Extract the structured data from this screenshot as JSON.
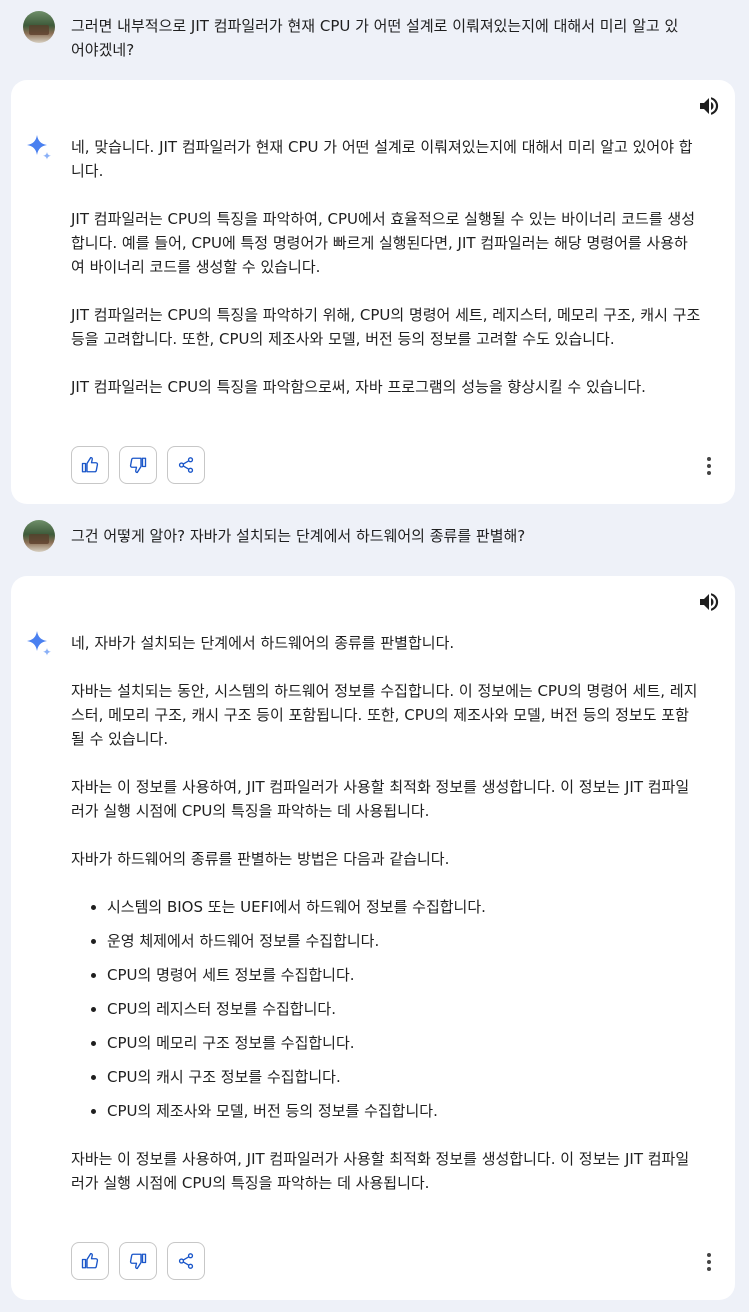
{
  "colors": {
    "background": "#eef1f8",
    "card": "#ffffff",
    "text": "#1f1f1f",
    "sparkle_blue": "#4a80f0",
    "icon_blue": "#1a56c9"
  },
  "icons": {
    "speaker": "volume-up-icon",
    "sparkle": "gemini-sparkle-icon",
    "thumbs_up": "thumbs-up-icon",
    "thumbs_down": "thumbs-down-icon",
    "share": "share-icon",
    "more": "more-vert-icon"
  },
  "conversation": [
    {
      "user": {
        "text": "그러면 내부적으로 JIT 컴파일러가 현재 CPU 가 어떤 설계로 이뤄져있는지에 대해서 미리 알고 있어야겠네?"
      },
      "model": {
        "paragraphs": [
          "네, 맞습니다. JIT 컴파일러가 현재 CPU 가 어떤 설계로 이뤄져있는지에 대해서 미리 알고 있어야 합니다.",
          "JIT 컴파일러는 CPU의 특징을 파악하여, CPU에서 효율적으로 실행될 수 있는 바이너리 코드를 생성합니다. 예를 들어, CPU에 특정 명령어가 빠르게 실행된다면, JIT 컴파일러는 해당 명령어를 사용하여 바이너리 코드를 생성할 수 있습니다.",
          "JIT 컴파일러는 CPU의 특징을 파악하기 위해, CPU의 명령어 세트, 레지스터, 메모리 구조, 캐시 구조 등을 고려합니다. 또한, CPU의 제조사와 모델, 버전 등의 정보를 고려할 수도 있습니다.",
          "JIT 컴파일러는 CPU의 특징을 파악함으로써, 자바 프로그램의 성능을 향상시킬 수 있습니다."
        ]
      }
    },
    {
      "user": {
        "text": "그건 어떻게 알아? 자바가 설치되는 단계에서 하드웨어의 종류를 판별해?"
      },
      "model": {
        "intro": [
          "네, 자바가 설치되는 단계에서 하드웨어의 종류를 판별합니다.",
          "자바는 설치되는 동안, 시스템의 하드웨어 정보를 수집합니다. 이 정보에는 CPU의 명령어 세트, 레지스터, 메모리 구조, 캐시 구조 등이 포함됩니다. 또한, CPU의 제조사와 모델, 버전 등의 정보도 포함될 수 있습니다.",
          "자바는 이 정보를 사용하여, JIT 컴파일러가 사용할 최적화 정보를 생성합니다. 이 정보는 JIT 컴파일러가 실행 시점에 CPU의 특징을 파악하는 데 사용됩니다.",
          "자바가 하드웨어의 종류를 판별하는 방법은 다음과 같습니다."
        ],
        "bullets": [
          "시스템의 BIOS 또는 UEFI에서 하드웨어 정보를 수집합니다.",
          "운영 체제에서 하드웨어 정보를 수집합니다.",
          "CPU의 명령어 세트 정보를 수집합니다.",
          "CPU의 레지스터 정보를 수집합니다.",
          "CPU의 메모리 구조 정보를 수집합니다.",
          "CPU의 캐시 구조 정보를 수집합니다.",
          "CPU의 제조사와 모델, 버전 등의 정보를 수집합니다."
        ],
        "outro": [
          "자바는 이 정보를 사용하여, JIT 컴파일러가 사용할 최적화 정보를 생성합니다. 이 정보는 JIT 컴파일러가 실행 시점에 CPU의 특징을 파악하는 데 사용됩니다."
        ]
      }
    }
  ]
}
